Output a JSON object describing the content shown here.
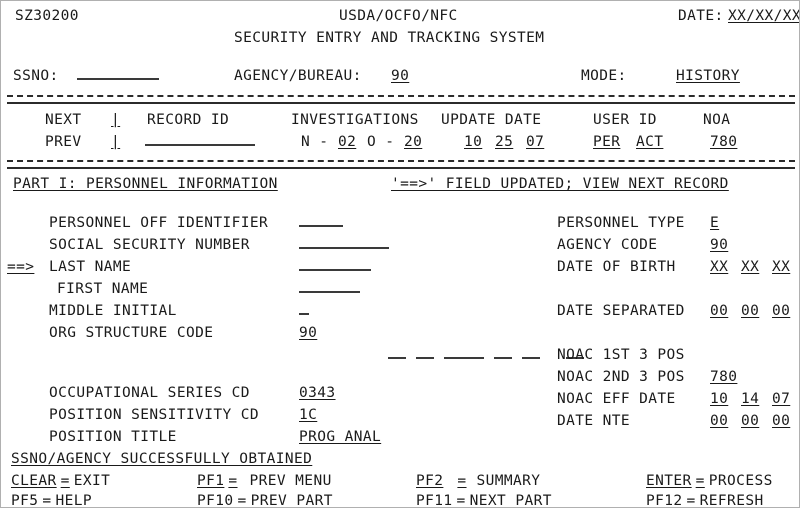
{
  "header": {
    "screen_id": "SZ30200",
    "agency_title": "USDA/OCFO/NFC",
    "system_title": "SECURITY ENTRY AND TRACKING SYSTEM",
    "date_label": "DATE:",
    "date_value": "XX/XX/XX"
  },
  "key_bar": {
    "ssno_label": "SSNO:",
    "ssno_value": "",
    "agency_bureau_label": "AGENCY/BUREAU:",
    "agency_bureau_value": "90",
    "mode_label": "MODE:",
    "mode_value": "HISTORY"
  },
  "record_nav": {
    "next_label": "NEXT",
    "next_value": "|",
    "prev_label": "PREV",
    "prev_value": "|",
    "columns": {
      "record_id": "RECORD ID",
      "investigations": "INVESTIGATIONS",
      "update_date": "UPDATE DATE",
      "user_id": "USER ID",
      "noa": "NOA"
    },
    "values": {
      "record_id": "",
      "inv_n_label": "N -",
      "inv_n_value": "02",
      "inv_o_label": "O -",
      "inv_o_value": "20",
      "update_mm": "10",
      "update_dd": "25",
      "update_yy": "07",
      "user_id_1": "PER",
      "user_id_2": "ACT",
      "noa": "780"
    }
  },
  "part_bar": {
    "part_title": "PART I: PERSONNEL INFORMATION",
    "status_message": "'==>' FIELD UPDATED; VIEW NEXT RECORD"
  },
  "cursor": {
    "marker": "==>"
  },
  "left_fields": [
    {
      "label": "PERSONNEL OFF IDENTIFIER",
      "value": "",
      "blank_width": 44
    },
    {
      "label": "SOCIAL SECURITY NUMBER",
      "value": "",
      "blank_width": 90
    },
    {
      "label": "LAST NAME",
      "value": "",
      "blank_width": 72
    },
    {
      "label": "FIRST NAME",
      "value": "",
      "blank_width": 61
    },
    {
      "label": "MIDDLE INITIAL",
      "value": "",
      "blank_width": 10
    }
  ],
  "org_structure": {
    "label": "ORG STRUCTURE CODE",
    "value": "90",
    "segment_widths": [
      18,
      18,
      40,
      18,
      18,
      18
    ]
  },
  "position_fields": [
    {
      "label": "OCCUPATIONAL SERIES CD",
      "value": "0343"
    },
    {
      "label": "POSITION SENSITIVITY CD",
      "value": "1C"
    },
    {
      "label": "POSITION TITLE",
      "value": "PROG ANAL"
    }
  ],
  "right_fields": [
    {
      "label": "PERSONNEL TYPE",
      "value": "E"
    },
    {
      "label": "AGENCY CODE",
      "value": "90"
    },
    {
      "label": "DATE OF BIRTH",
      "value_parts": [
        "XX",
        "XX",
        "XX"
      ]
    },
    {
      "label": "DATE SEPARATED",
      "value_parts": [
        "00",
        "00",
        "00"
      ]
    }
  ],
  "noac_fields": [
    {
      "label": "NOAC 1ST 3 POS",
      "value": ""
    },
    {
      "label": "NOAC 2ND 3 POS",
      "value": "780"
    },
    {
      "label": "NOAC EFF DATE",
      "value_parts": [
        "10",
        "14",
        "07"
      ]
    },
    {
      "label": "DATE NTE",
      "value_parts": [
        "00",
        "00",
        "00"
      ]
    }
  ],
  "status_line": "SSNO/AGENCY SUCCESSFULLY OBTAINED",
  "function_keys": [
    {
      "key": "CLEAR",
      "eq": "=",
      "action": "EXIT"
    },
    {
      "key": "PF1",
      "eq": "=",
      "action": "PREV MENU"
    },
    {
      "key": "PF2",
      "eq": "=",
      "action": "SUMMARY"
    },
    {
      "key": "ENTER",
      "eq": "=",
      "action": "PROCESS"
    },
    {
      "key": "PF5",
      "eq": "=",
      "action": "HELP"
    },
    {
      "key": "PF10",
      "eq": "=",
      "action": "PREV PART"
    },
    {
      "key": "PF11",
      "eq": "=",
      "action": "NEXT PART"
    },
    {
      "key": "PF12",
      "eq": "=",
      "action": "REFRESH"
    }
  ]
}
